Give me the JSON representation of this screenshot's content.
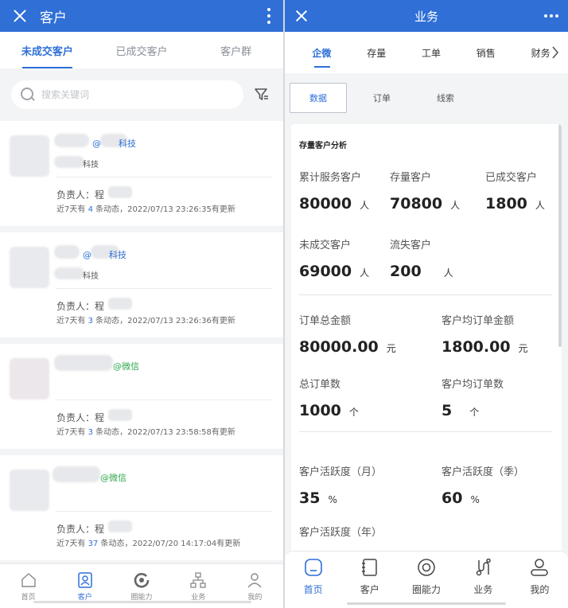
{
  "left": {
    "title": "客户",
    "tabs": [
      "未成交客户",
      "已成交客户",
      "客户群"
    ],
    "search_placeholder": "搜索关键词",
    "cards": [
      {
        "tag": "@　　科技",
        "tag_color": "#2f6fd6",
        "sub": "科技",
        "owner": "负责人：程",
        "status_pre": "近7天有",
        "count": "4",
        "status_post": "条动态，2022/07/13 23:26:35有更新"
      },
      {
        "tag": "@　　科技",
        "tag_color": "#2f6fd6",
        "sub": "科技",
        "owner": "负责人：程",
        "status_pre": "近7天有",
        "count": "3",
        "status_post": "条动态，2022/07/13 23:26:36有更新"
      },
      {
        "tag": "@微信",
        "tag_color": "#2fa84f",
        "sub": "",
        "owner": "负责人：程",
        "status_pre": "近7天有",
        "count": "3",
        "status_post": "条动态，2022/07/13 23:58:58有更新"
      },
      {
        "tag": "@微信",
        "tag_color": "#2fa84f",
        "sub": "",
        "owner": "负责人：程",
        "status_pre": "近7天有",
        "count": "37",
        "status_post": "条动态，2022/07/20 14:17:04有更新"
      }
    ],
    "nav": [
      {
        "label": "首页",
        "icon": "home-icon"
      },
      {
        "label": "客户",
        "icon": "contact-card-icon"
      },
      {
        "label": "圈能力",
        "icon": "loop-icon"
      },
      {
        "label": "业务",
        "icon": "hierarchy-icon"
      },
      {
        "label": "我的",
        "icon": "person-icon"
      }
    ]
  },
  "right": {
    "title": "业务",
    "tabs": [
      "企微",
      "存量",
      "工单",
      "销售",
      "财务"
    ],
    "subtabs": [
      "数据",
      "订单",
      "线索"
    ],
    "section_title": "存量客户分析",
    "stats": [
      {
        "label": "累计服务客户",
        "value": "80000",
        "unit": "人"
      },
      {
        "label": "存量客户",
        "value": "70800",
        "unit": "人"
      },
      {
        "label": "已成交客户",
        "value": "1800",
        "unit": "人"
      },
      {
        "label": "未成交客户",
        "value": "69000",
        "unit": "人"
      },
      {
        "label": "流失客户",
        "value": "200",
        "unit": "人"
      },
      {
        "label": "订单总金额",
        "value": "80000.00",
        "unit": "元"
      },
      {
        "label": "客户均订单金额",
        "value": "1800.00",
        "unit": "元"
      },
      {
        "label": "总订单数",
        "value": "1000",
        "unit": "个"
      },
      {
        "label": "客户均订单数",
        "value": "5",
        "unit": "个"
      },
      {
        "label": "客户活跃度（月）",
        "value": "35",
        "unit": "%"
      },
      {
        "label": "客户活跃度（季）",
        "value": "60",
        "unit": "%"
      },
      {
        "label": "客户活跃度（年）",
        "value": "",
        "unit": ""
      }
    ],
    "nav": [
      {
        "label": "首页",
        "icon": "home-icon"
      },
      {
        "label": "客户",
        "icon": "notebook-icon"
      },
      {
        "label": "圈能力",
        "icon": "target-icon"
      },
      {
        "label": "业务",
        "icon": "business-icon"
      },
      {
        "label": "我的",
        "icon": "person-icon"
      }
    ]
  },
  "colors": {
    "primary": "#2f6fd6",
    "green_tag": "#2fa84f",
    "background": "#f3f4f6"
  }
}
